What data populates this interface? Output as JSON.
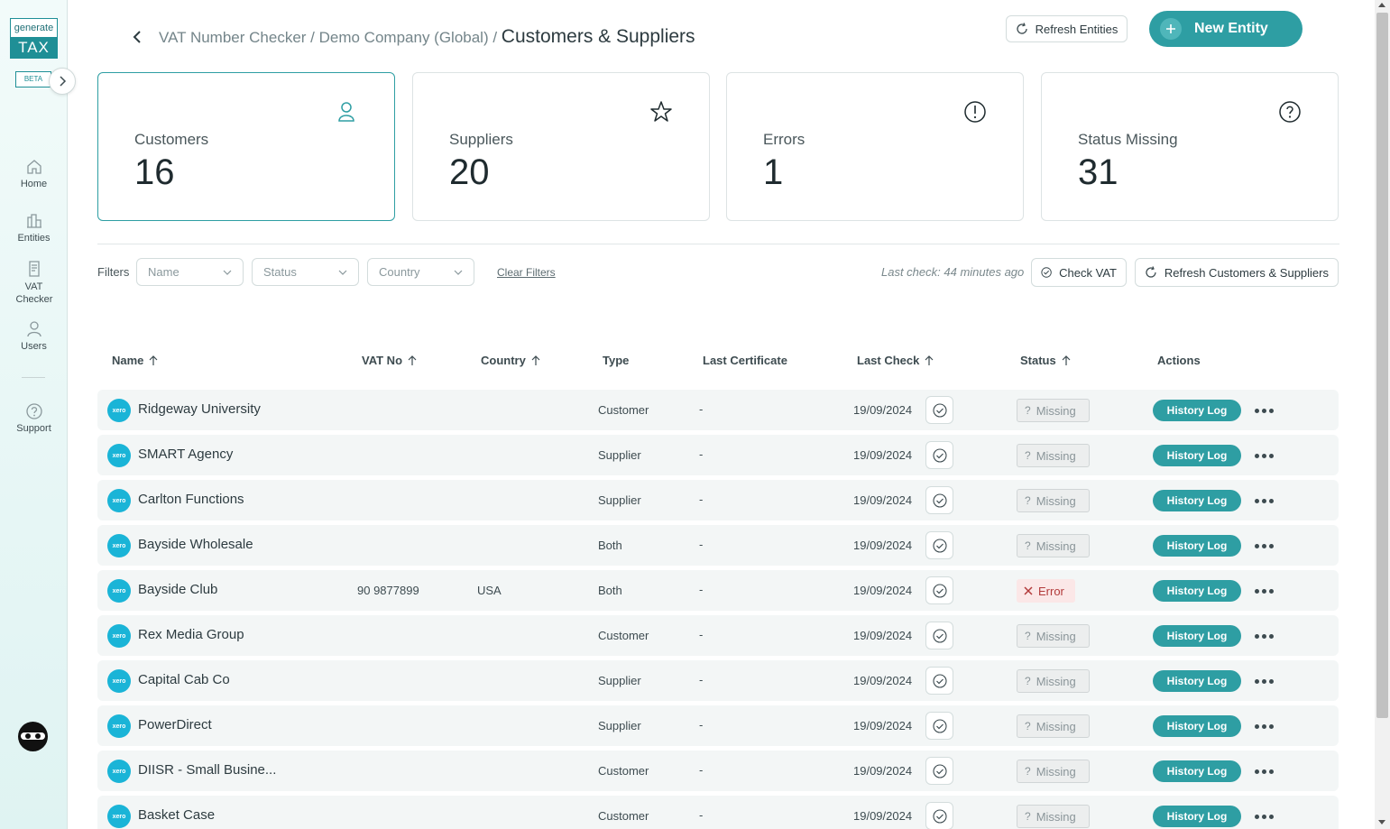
{
  "sidebar": {
    "logo_top": "generate",
    "logo_bottom": "TAX",
    "beta": "BETA",
    "items": [
      {
        "label": "Home"
      },
      {
        "label": "Entities"
      },
      {
        "label": "VAT Checker"
      },
      {
        "label": "Users"
      },
      {
        "label": "Support"
      }
    ]
  },
  "header": {
    "breadcrumb_parent": "VAT Number Checker / Demo Company (Global) / ",
    "breadcrumb_current": "Customers & Suppliers",
    "refresh_entities": "Refresh Entities",
    "new_entity": "New Entity"
  },
  "cards": [
    {
      "label": "Customers",
      "value": "16"
    },
    {
      "label": "Suppliers",
      "value": "20"
    },
    {
      "label": "Errors",
      "value": "1"
    },
    {
      "label": "Status Missing",
      "value": "31"
    }
  ],
  "filters": {
    "label": "Filters",
    "name": "Name",
    "status": "Status",
    "country": "Country",
    "clear": "Clear Filters",
    "last_check": "Last check: 44 minutes ago",
    "check_vat": "Check VAT",
    "refresh_cs": "Refresh Customers & Suppliers"
  },
  "table": {
    "headers": {
      "name": "Name",
      "vat": "VAT No",
      "country": "Country",
      "type": "Type",
      "cert": "Last Certificate",
      "last_check": "Last Check",
      "status": "Status",
      "actions": "Actions"
    },
    "history_label": "History Log",
    "xero_label": "xero",
    "rows": [
      {
        "name": "Ridgeway University",
        "vat": "",
        "country": "",
        "type": "Customer",
        "cert": "-",
        "date": "19/09/2024",
        "status": "Missing",
        "kind": "missing"
      },
      {
        "name": "SMART Agency",
        "vat": "",
        "country": "",
        "type": "Supplier",
        "cert": "-",
        "date": "19/09/2024",
        "status": "Missing",
        "kind": "missing"
      },
      {
        "name": "Carlton Functions",
        "vat": "",
        "country": "",
        "type": "Supplier",
        "cert": "-",
        "date": "19/09/2024",
        "status": "Missing",
        "kind": "missing"
      },
      {
        "name": "Bayside Wholesale",
        "vat": "",
        "country": "",
        "type": "Both",
        "cert": "-",
        "date": "19/09/2024",
        "status": "Missing",
        "kind": "missing"
      },
      {
        "name": "Bayside Club",
        "vat": "90 9877899",
        "country": "USA",
        "type": "Both",
        "cert": "-",
        "date": "19/09/2024",
        "status": "Error",
        "kind": "error"
      },
      {
        "name": "Rex Media Group",
        "vat": "",
        "country": "",
        "type": "Customer",
        "cert": "-",
        "date": "19/09/2024",
        "status": "Missing",
        "kind": "missing"
      },
      {
        "name": "Capital Cab Co",
        "vat": "",
        "country": "",
        "type": "Supplier",
        "cert": "-",
        "date": "19/09/2024",
        "status": "Missing",
        "kind": "missing"
      },
      {
        "name": "PowerDirect",
        "vat": "",
        "country": "",
        "type": "Supplier",
        "cert": "-",
        "date": "19/09/2024",
        "status": "Missing",
        "kind": "missing"
      },
      {
        "name": "DIISR - Small Busine...",
        "vat": "",
        "country": "",
        "type": "Customer",
        "cert": "-",
        "date": "19/09/2024",
        "status": "Missing",
        "kind": "missing"
      },
      {
        "name": "Basket Case",
        "vat": "",
        "country": "",
        "type": "Customer",
        "cert": "-",
        "date": "19/09/2024",
        "status": "Missing",
        "kind": "missing"
      }
    ]
  },
  "colors": {
    "accent": "#2e9ea3",
    "xero": "#1ab4d7",
    "error": "#b23a3a"
  }
}
